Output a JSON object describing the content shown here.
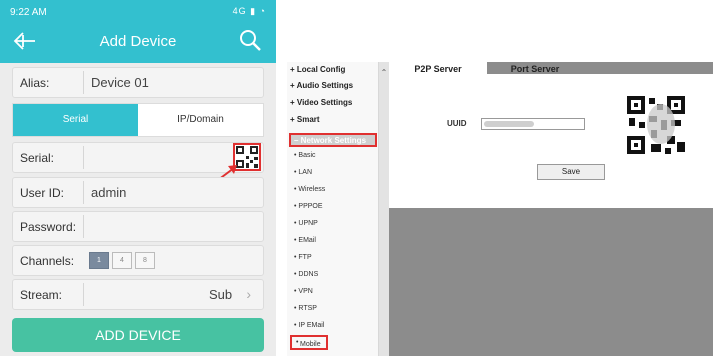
{
  "phone": {
    "status_time": "9:22 AM",
    "status_icons": "4G ▮ ◔",
    "title": "Add Device",
    "fields": {
      "alias_label": "Alias:",
      "alias_value": "Device 01",
      "serial_label": "Serial:",
      "userid_label": "User ID:",
      "userid_value": "admin",
      "password_label": "Password:",
      "channels_label": "Channels:",
      "stream_label": "Stream:",
      "stream_value": "Sub"
    },
    "tabs": {
      "serial": "Serial",
      "ip_domain": "IP/Domain"
    },
    "channel_options": [
      "1",
      "4",
      "8"
    ],
    "add_button": "ADD DEVICE",
    "colors": {
      "header": "#33c0cf",
      "add_button": "#47c2a2",
      "highlight": "#e03030"
    }
  },
  "web": {
    "menu": {
      "local_config": "+ Local Config",
      "audio_settings": "+ Audio Settings",
      "video_settings": "+ Video Settings",
      "smart": "+ Smart",
      "network_settings": "– Network Settings",
      "items": [
        "Basic",
        "LAN",
        "Wireless",
        "PPPOE",
        "UPNP",
        "EMail",
        "FTP",
        "DDNS",
        "VPN",
        "RTSP",
        "IP EMail"
      ],
      "mobile": "Mobile"
    },
    "tabs": {
      "p2p": "P2P Server",
      "port": "Port Server"
    },
    "uuid_label": "UUID",
    "save_button": "Save"
  }
}
